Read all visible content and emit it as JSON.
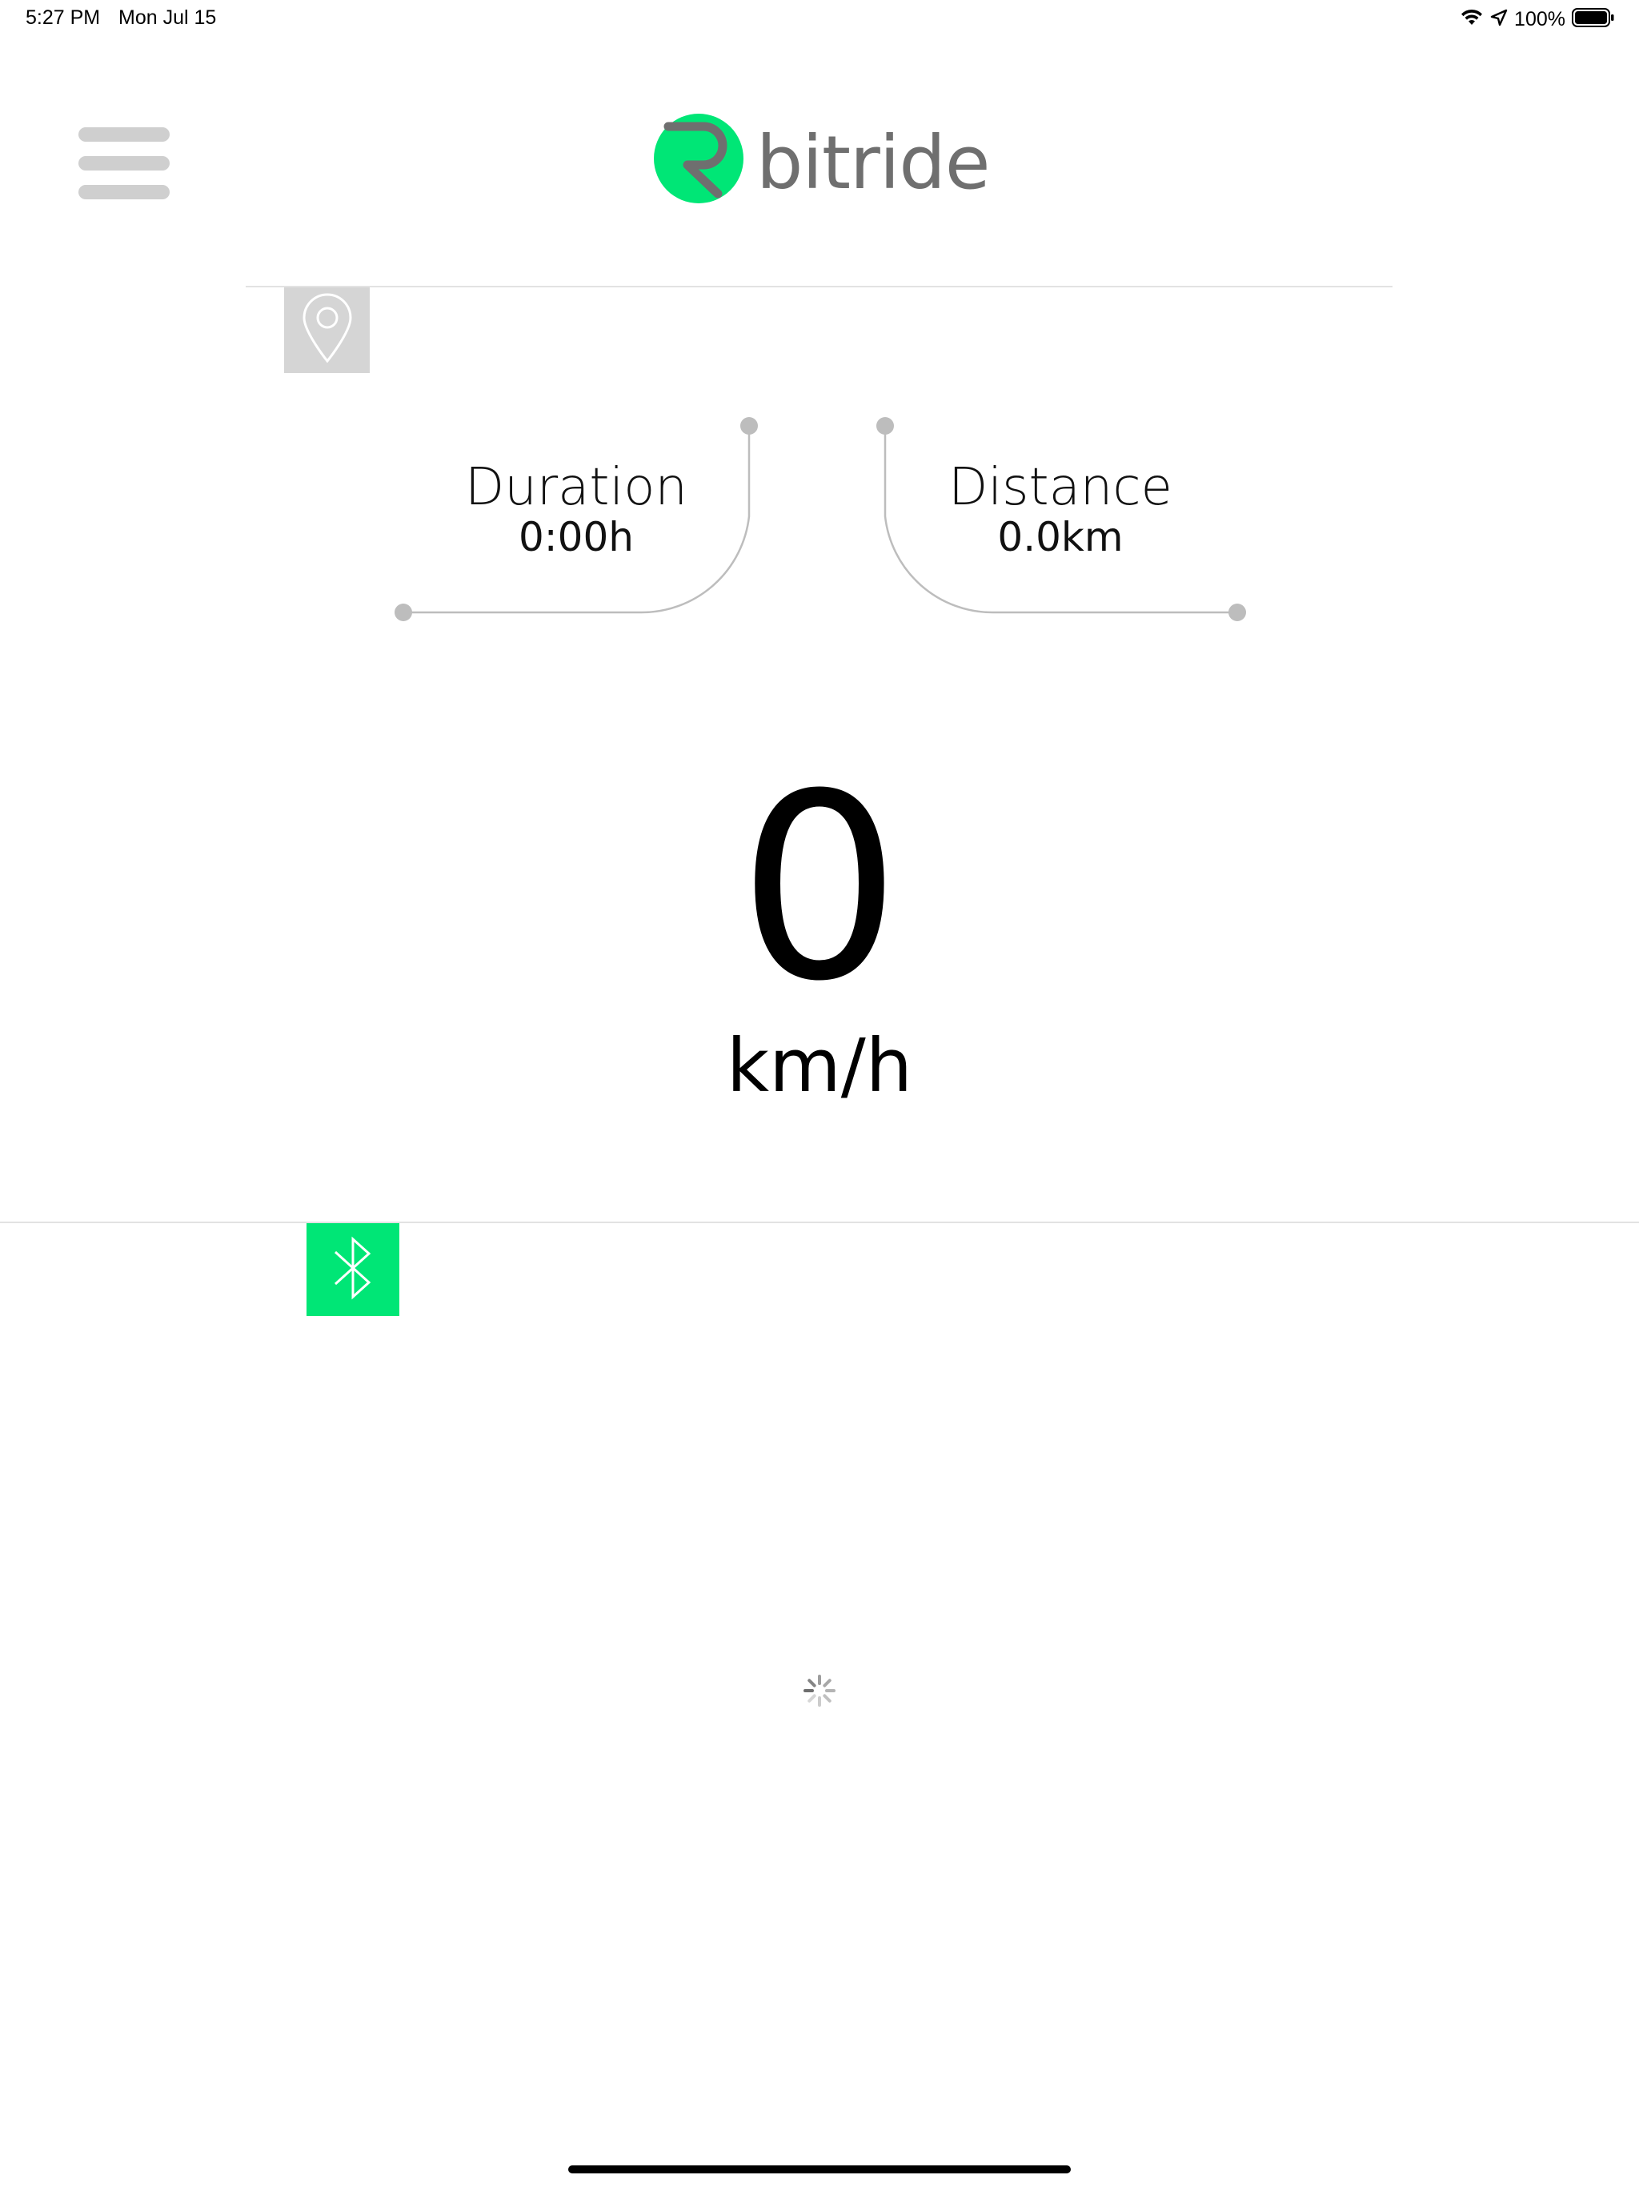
{
  "status_bar": {
    "time": "5:27 PM",
    "date": "Mon Jul 15",
    "battery_percent": "100%",
    "icons": [
      "wifi-icon",
      "location-arrow-icon",
      "battery-icon"
    ]
  },
  "header": {
    "menu_icon": "hamburger-menu-icon",
    "logo_text": "bitride",
    "logo_color": "#00e676"
  },
  "location": {
    "icon": "map-pin-icon"
  },
  "stats": {
    "duration_label": "Duration",
    "duration_value": "0:00h",
    "distance_label": "Distance",
    "distance_value": "0.0km"
  },
  "speed": {
    "value": "0",
    "unit": "km/h"
  },
  "bluetooth": {
    "icon": "bluetooth-icon",
    "color": "#00e676"
  },
  "loading": {
    "icon": "activity-spinner-icon"
  }
}
